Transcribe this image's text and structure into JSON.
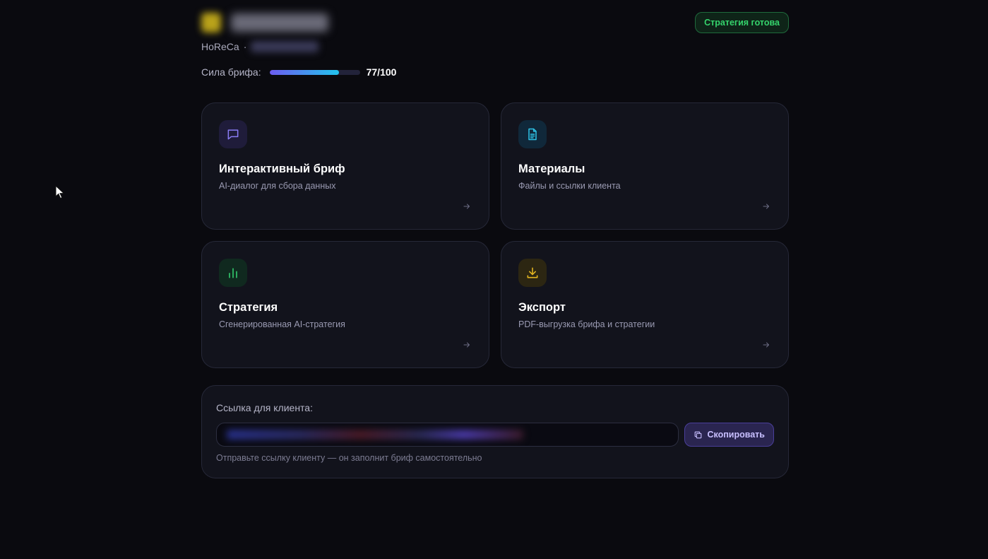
{
  "header": {
    "segment": "HoReCa",
    "separator": "·",
    "strength_label": "Сила брифа:",
    "strength_score": "77/100",
    "strength_fraction": 0.77,
    "status_badge": "Стратегия готова"
  },
  "cards": [
    {
      "title": "Интерактивный бриф",
      "subtitle": "AI-диалог для сбора данных",
      "icon": "chat-icon",
      "accent": "#8b7cf6",
      "icon_bg": "#1f1c3a"
    },
    {
      "title": "Материалы",
      "subtitle": "Файлы и ссылки клиента",
      "icon": "document-icon",
      "accent": "#2ec3e6",
      "icon_bg": "#10283a"
    },
    {
      "title": "Стратегия",
      "subtitle": "Сгенерированная AI-стратегия",
      "icon": "bar-chart-icon",
      "accent": "#31c46a",
      "icon_bg": "#10291f"
    },
    {
      "title": "Экспорт",
      "subtitle": "PDF-выгрузка брифа и стратегии",
      "icon": "download-icon",
      "accent": "#e3b520",
      "icon_bg": "#2c2612"
    }
  ],
  "client_link": {
    "label": "Ссылка для клиента:",
    "copy_label": "Скопировать",
    "hint": "Отправьте ссылку клиенту — он заполнит бриф самостоятельно"
  },
  "colors": {
    "background": "#0a0a0f",
    "card": "#12131c",
    "card_border": "#262838",
    "badge_green": "#35d36c",
    "bar_start": "#6d5cf0",
    "bar_end": "#22c4ee"
  }
}
